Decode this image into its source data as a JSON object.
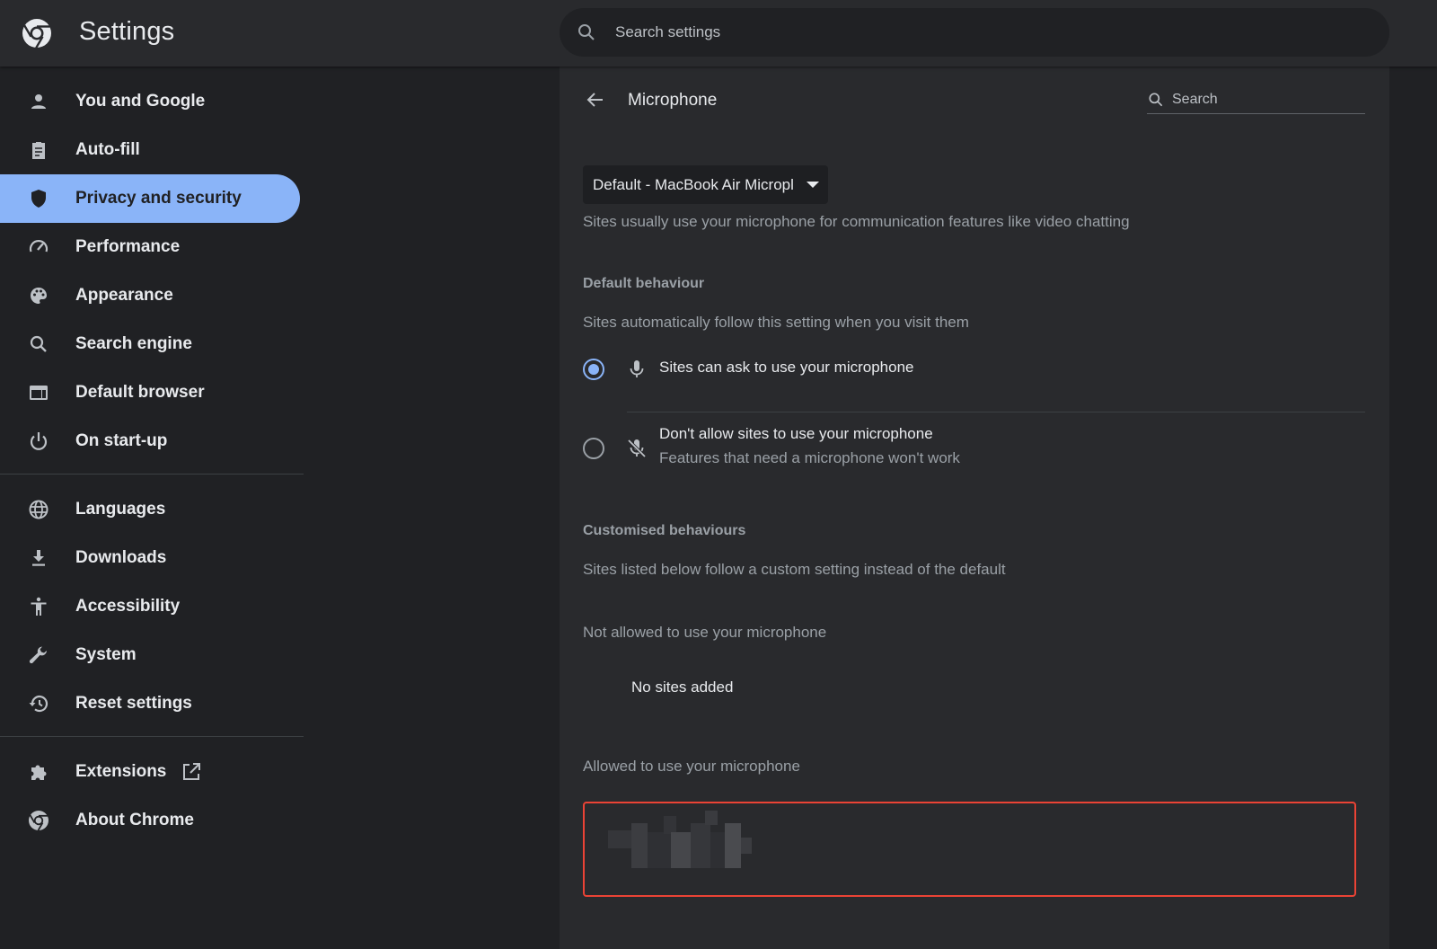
{
  "header": {
    "app_title": "Settings",
    "logo_icon": "chrome-logo-icon",
    "search_placeholder": "Search settings"
  },
  "sidebar": {
    "active_color": "#8ab4f8",
    "items": [
      {
        "label": "You and Google",
        "icon": "person-icon"
      },
      {
        "label": "Auto-fill",
        "icon": "clipboard-icon"
      },
      {
        "label": "Privacy and security",
        "icon": "shield-icon",
        "active": true
      },
      {
        "label": "Performance",
        "icon": "speedometer-icon"
      },
      {
        "label": "Appearance",
        "icon": "palette-icon"
      },
      {
        "label": "Search engine",
        "icon": "search-icon"
      },
      {
        "label": "Default browser",
        "icon": "browser-icon"
      },
      {
        "label": "On start-up",
        "icon": "power-icon"
      },
      {
        "label": "Languages",
        "icon": "globe-icon"
      },
      {
        "label": "Downloads",
        "icon": "download-icon"
      },
      {
        "label": "Accessibility",
        "icon": "accessibility-icon"
      },
      {
        "label": "System",
        "icon": "wrench-icon"
      },
      {
        "label": "Reset settings",
        "icon": "history-icon"
      },
      {
        "label": "Extensions",
        "icon": "puzzle-icon",
        "external": true
      },
      {
        "label": "About Chrome",
        "icon": "chrome-icon"
      }
    ]
  },
  "main": {
    "title": "Microphone",
    "search_placeholder": "Search",
    "device_select": {
      "value": "Default - MacBook Air Micropl"
    },
    "device_description": "Sites usually use your microphone for communication features like video chatting",
    "default_behaviour": {
      "heading": "Default behaviour",
      "description": "Sites automatically follow this setting when you visit them",
      "options": [
        {
          "label": "Sites can ask to use your microphone",
          "icon": "microphone-icon",
          "checked": true
        },
        {
          "label": "Don't allow sites to use your microphone",
          "sublabel": "Features that need a microphone won't work",
          "icon": "microphone-off-icon",
          "checked": false
        }
      ]
    },
    "customised_behaviours": {
      "heading": "Customised behaviours",
      "description": "Sites listed below follow a custom setting instead of the default",
      "not_allowed": {
        "heading": "Not allowed to use your microphone",
        "empty_text": "No sites added"
      },
      "allowed": {
        "heading": "Allowed to use your microphone",
        "highlight_color": "#ea4335"
      }
    }
  }
}
